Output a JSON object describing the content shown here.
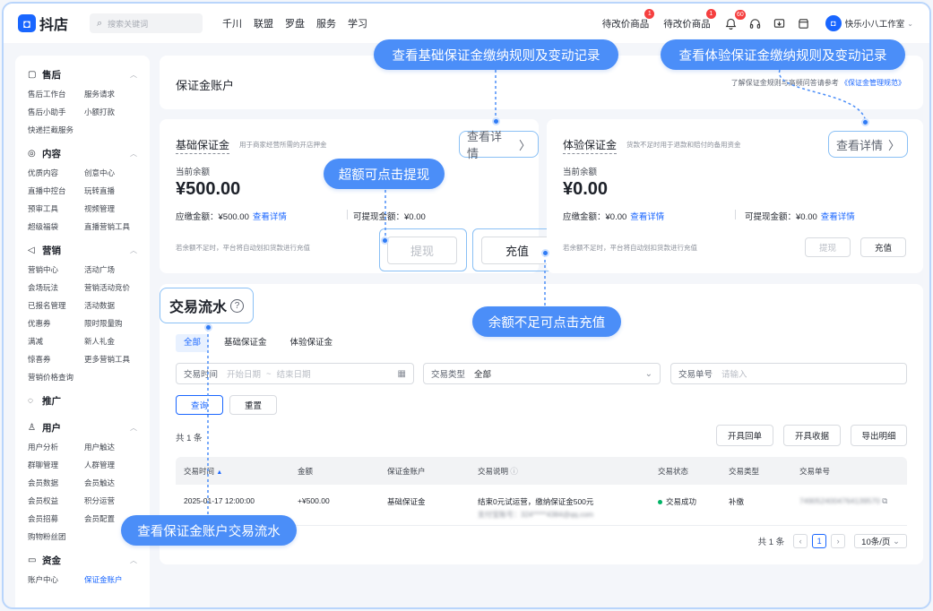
{
  "topbar": {
    "logo_text": "抖店",
    "search_placeholder": "搜索关键词",
    "nav": [
      "千川",
      "联盟",
      "罗盘",
      "服务",
      "学习"
    ],
    "pending_1": "待改价商品",
    "pending_1_badge": "1",
    "pending_2": "待改价商品",
    "pending_2_badge": "1",
    "bell_badge": "60",
    "user_name": "快乐小八工作室"
  },
  "sidebar": {
    "sections": [
      {
        "title": "售后",
        "icon": "shopping-bag-icon",
        "items": [
          "售后工作台",
          "服务请求",
          "售后小助手",
          "小额打款",
          "快递拦截服务"
        ]
      },
      {
        "title": "内容",
        "icon": "content-icon",
        "items": [
          "优质内容",
          "创意中心",
          "直播中控台",
          "玩转直播",
          "预审工具",
          "视频管理",
          "超级福袋",
          "直播营销工具"
        ]
      },
      {
        "title": "营销",
        "icon": "megaphone-icon",
        "items": [
          "营销中心",
          "活动广场",
          "会场玩法",
          "营销活动竞价",
          "已报名管理",
          "活动数据",
          "优惠券",
          "限时限量购",
          "满减",
          "新人礼金",
          "惊喜券",
          "更多营销工具",
          "营销价格查询"
        ]
      },
      {
        "title": "推广",
        "icon": "promote-icon",
        "items": []
      },
      {
        "title": "用户",
        "icon": "user-icon",
        "items": [
          "用户分析",
          "用户触达",
          "群聊管理",
          "人群管理",
          "会员数据",
          "会员触达",
          "会员权益",
          "积分运营",
          "会员招募",
          "会员配置",
          "购物粉丝团"
        ]
      },
      {
        "title": "资金",
        "icon": "wallet-icon",
        "items": [
          "账户中心",
          "保证金账户"
        ]
      }
    ],
    "active_item": "保证金账户"
  },
  "account": {
    "title": "保证金账户",
    "note_prefix": "了解保证金规则与高频问答请参考",
    "note_link": "《保证金管理规范》"
  },
  "basic": {
    "title": "基础保证金",
    "desc": "用于商家经营所需的开店押金",
    "detail_btn": "查看详情",
    "balance_label": "当前余额",
    "balance": "¥500.00",
    "due_label": "应缴金额：",
    "due": "¥500.00",
    "due_link": "查看详情",
    "withdrawable_label": "可提现金额：",
    "withdrawable": "¥0.00",
    "foot": "若余额不足时，平台将自动划扣货款进行充值",
    "withdraw_btn": "提现",
    "recharge_btn": "充值"
  },
  "trial": {
    "title": "体验保证金",
    "desc": "货款不足时用于退款和赔付的备用资金",
    "detail_btn": "查看详情",
    "balance_label": "当前余额",
    "balance": "¥0.00",
    "due_label": "应缴金额：",
    "due": "¥0.00",
    "due_link": "查看详情",
    "withdrawable_label": "可提现金额：",
    "withdrawable": "¥0.00",
    "withdrawable_link": "查看详情",
    "foot": "若余额不足时，平台将自动划扣货款进行充值",
    "withdraw_btn": "提现",
    "recharge_btn": "充值"
  },
  "transactions": {
    "title": "交易流水",
    "tabs": [
      "全部",
      "基础保证金",
      "体验保证金"
    ],
    "filters": {
      "time_label": "交易时间",
      "time_start": "开始日期",
      "time_sep": "~",
      "time_end": "结束日期",
      "type_label": "交易类型",
      "type_value": "全部",
      "no_label": "交易单号",
      "no_placeholder": "请输入"
    },
    "query_btn": "查询",
    "reset_btn": "重置",
    "count": "共 1 条",
    "actions": [
      "开具回单",
      "开具收据",
      "导出明细"
    ],
    "columns": [
      "交易时间",
      "金额",
      "保证金账户",
      "交易说明",
      "交易状态",
      "交易类型",
      "交易单号"
    ],
    "rows": [
      {
        "time": "2025-01-17 12:00:00",
        "amount": "+¥500.00",
        "account": "基础保证金",
        "desc": "结束0元试运营，缴纳保证金500元",
        "desc_sub": "支付宝账号：324*****4384@qq.com",
        "status": "交易成功",
        "type": "补缴",
        "no": "7490524004764139570"
      }
    ],
    "pager": {
      "total": "共 1 条",
      "current": "1",
      "size": "10条/页"
    }
  },
  "callouts": {
    "basic_rules": "查看基础保证金缴纳规则及变动记录",
    "trial_rules": "查看体验保证金缴纳规则及变动记录",
    "withdraw": "超额可点击提现",
    "recharge": "余额不足可点击充值",
    "flow": "查看保证金账户交易流水"
  },
  "colors": {
    "accent": "#1966ff",
    "callout": "#4b8ef8",
    "success": "#00b365",
    "badge": "#f53f3f"
  }
}
